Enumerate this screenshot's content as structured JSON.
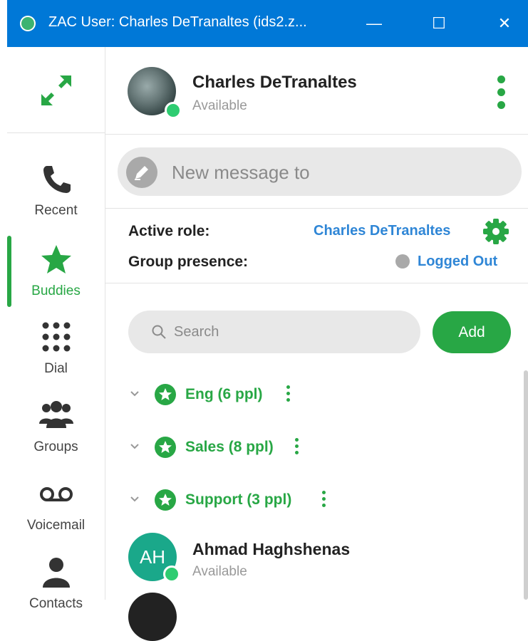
{
  "window": {
    "title": "ZAC User: Charles DeTranaltes (ids2.z...",
    "minimize": "—",
    "maximize": "☐",
    "close": "✕"
  },
  "colors": {
    "titlebar": "#0078d7",
    "accent": "#28a745",
    "link": "#2f86d6",
    "presence_available": "#2ecc71",
    "presence_logged_out": "#a9a9a9"
  },
  "nav": {
    "expand_icon": "expand-arrows-icon",
    "items": [
      {
        "label": "Recent",
        "icon": "phone-icon",
        "active": false
      },
      {
        "label": "Buddies",
        "icon": "star-icon",
        "active": true
      },
      {
        "label": "Dial",
        "icon": "dialpad-icon",
        "active": false
      },
      {
        "label": "Groups",
        "icon": "groups-icon",
        "active": false
      },
      {
        "label": "Voicemail",
        "icon": "voicemail-icon",
        "active": false
      },
      {
        "label": "Contacts",
        "icon": "contact-person-icon",
        "active": false
      }
    ]
  },
  "profile": {
    "name": "Charles DeTranaltes",
    "status": "Available"
  },
  "message": {
    "placeholder": "New message to"
  },
  "roles": {
    "active_role_label": "Active role:",
    "active_role_value": "Charles DeTranaltes",
    "group_presence_label": "Group presence:",
    "group_presence_value": "Logged Out"
  },
  "search": {
    "placeholder": "Search",
    "add_label": "Add"
  },
  "groups": [
    {
      "label": "Eng (6 ppl)"
    },
    {
      "label": "Sales (8 ppl)"
    },
    {
      "label": "Support (3 ppl)"
    }
  ],
  "contacts": [
    {
      "initials": "AH",
      "name": "Ahmad Haghshenas",
      "status": "Available"
    }
  ]
}
